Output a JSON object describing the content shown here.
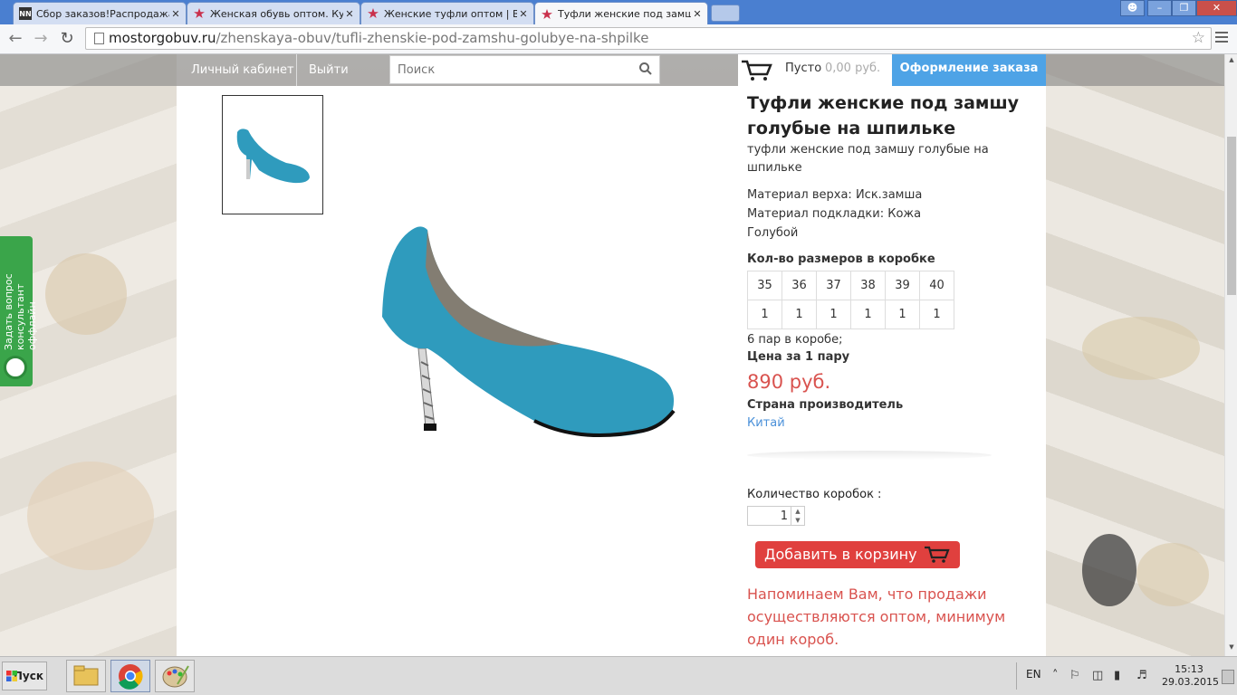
{
  "browser": {
    "tabs": [
      {
        "title": "Сбор заказов!Распродажа дешево",
        "favicon": "NN"
      },
      {
        "title": "Женская обувь оптом. Купить",
        "favicon": "star-icon"
      },
      {
        "title": "Женские туфли оптом | Ве",
        "favicon": "star-icon"
      },
      {
        "title": "Туфли женские под замшу",
        "favicon": "star-icon",
        "active": true
      }
    ],
    "close_glyph": "✕",
    "url_domain": "mostorgobuv.ru",
    "url_path": "/zhenskaya-obuv/tufli-zhenskie-pod-zamshu-golubye-na-shpilke"
  },
  "site": {
    "nav": {
      "account": "Личный кабинет",
      "logout": "Выйти",
      "search_placeholder": "Поиск"
    },
    "cart": {
      "empty": "Пусто",
      "sum": "0,00 руб.",
      "checkout": "Оформление заказа"
    },
    "side_widget": {
      "line1": "Задать вопрос",
      "line2": "консультант оффлайн"
    }
  },
  "product": {
    "title": "Туфли женские под замшу голубые на шпильке",
    "subtitle": "туфли женские под замшу голубые на шпильке",
    "material_top": "Материал верха: Иск.замша",
    "material_lining": "Материал подкладки: Кожа",
    "color": "Голубой",
    "sizes_header": "Кол-во размеров в коробке",
    "sizes": [
      "35",
      "36",
      "37",
      "38",
      "39",
      "40"
    ],
    "size_counts": [
      "1",
      "1",
      "1",
      "1",
      "1",
      "1"
    ],
    "pairs_per_box": "6 пар в коробе;",
    "price_label": "Цена за 1 пару",
    "price": "890 руб.",
    "country_label": "Страна производитель",
    "country": "Китай",
    "qty_label": "Количество коробок :",
    "qty_value": "1",
    "add_to_cart": "Добавить в корзину",
    "notice": "Напоминаем Вам, что продажи осуществляются оптом, минимум один короб.",
    "shoe_color": "#2f9bbd"
  },
  "taskbar": {
    "start": "Пуск",
    "lang": "EN",
    "time": "15:13",
    "date": "29.03.2015"
  }
}
